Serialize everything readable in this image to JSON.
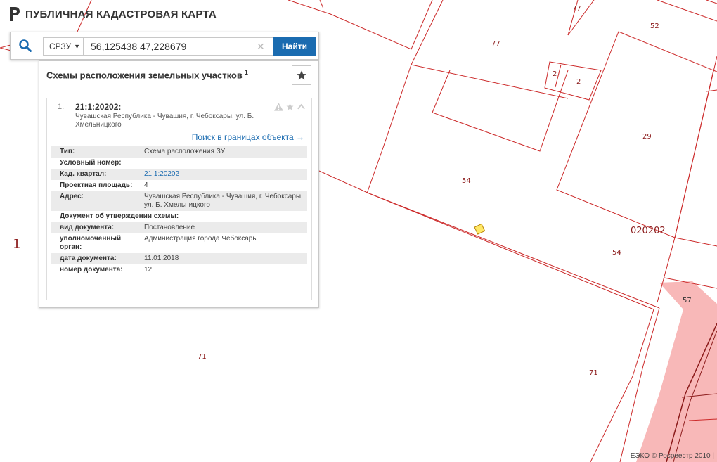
{
  "header": {
    "title": "ПУБЛИЧНАЯ КАДАСТРОВАЯ КАРТА"
  },
  "search": {
    "type_label": "СРЗУ",
    "query": "56,125438 47,228679",
    "find_label": "Найти"
  },
  "panel": {
    "title": "Схемы расположения земельных участков",
    "count": "1",
    "result": {
      "index": "1.",
      "id": "21:1:20202:",
      "address_short": "Чувашская Республика - Чувашия, г. Чебоксары, ул. Б. Хмельницкого",
      "search_link": "Поиск в границах объекта →",
      "props": [
        {
          "k": "Тип:",
          "v": "Схема расположения ЗУ"
        },
        {
          "k": "Условный номер:",
          "v": ""
        },
        {
          "k": "Кад. квартал:",
          "v": "21:1:20202",
          "link": true
        },
        {
          "k": "Проектная площадь:",
          "v": "4"
        },
        {
          "k": "Адрес:",
          "v": "Чувашская Республика - Чувашия, г. Чебоксары, ул. Б. Хмельницкого"
        },
        {
          "k": "Документ об утверждении схемы:",
          "v": "",
          "full": true
        },
        {
          "k": "вид документа:",
          "v": "Постановление"
        },
        {
          "k": "уполномоченный орган:",
          "v": "Администрация города Чебоксары"
        },
        {
          "k": "дата документа:",
          "v": "11.01.2018"
        },
        {
          "k": "номер документа:",
          "v": "12"
        }
      ]
    }
  },
  "map": {
    "labels": [
      "77",
      "52",
      "77",
      "2",
      "2",
      "29",
      "54",
      "020202",
      "54",
      "57",
      "71",
      "71",
      "1"
    ],
    "colors": {
      "boundary": "#cc2a2a",
      "road": "#f8b8b8",
      "parcel": "#ffe866"
    }
  },
  "copyright": "ЕЭКО © Росреестр 2010 |"
}
